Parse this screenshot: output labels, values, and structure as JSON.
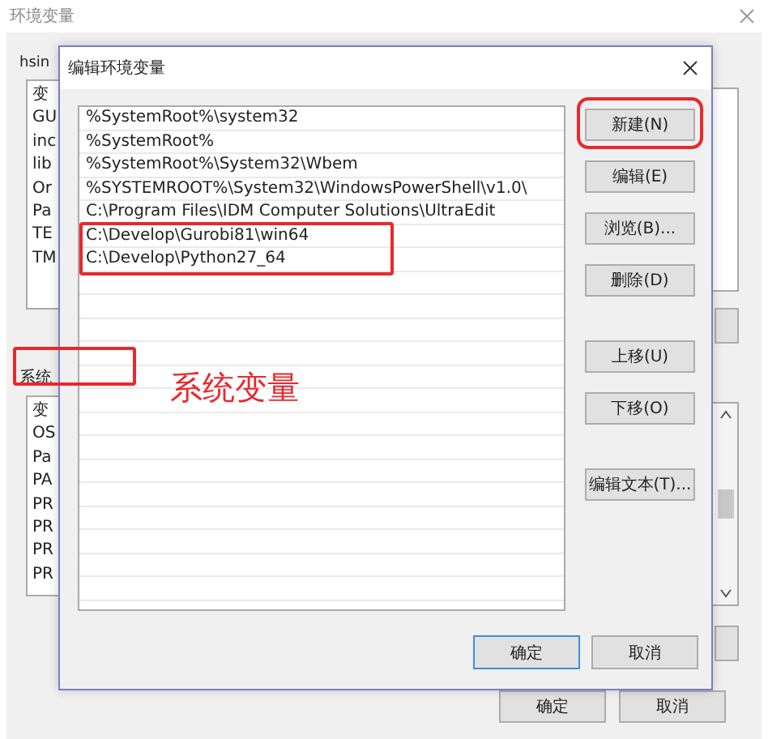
{
  "background_window": {
    "title": "环境变量",
    "user_section": {
      "label": "hsin"
    },
    "user_variables": [
      "变",
      "GU",
      "inc",
      "lib",
      "Or",
      "Pa",
      "TE",
      "TM"
    ],
    "system_section": {
      "label": "系统",
      "annotated": true
    },
    "system_variables": [
      "变",
      "OS",
      "Pa",
      "PA",
      "PR",
      "PR",
      "PR",
      "PR"
    ],
    "buttons": [
      "确定",
      "取消"
    ]
  },
  "dialog": {
    "title": "编辑环境变量",
    "entries": [
      {
        "text": "%SystemRoot%\\system32",
        "annotated": false
      },
      {
        "text": "%SystemRoot%",
        "annotated": false
      },
      {
        "text": "%SystemRoot%\\System32\\Wbem",
        "annotated": false
      },
      {
        "text": "%SYSTEMROOT%\\System32\\WindowsPowerShell\\v1.0\\",
        "annotated": false
      },
      {
        "text": "C:\\Program Files\\IDM Computer Solutions\\UltraEdit",
        "annotated": false
      },
      {
        "text": "C:\\Develop\\Gurobi81\\win64",
        "annotated": true
      },
      {
        "text": "C:\\Develop\\Python27_64",
        "annotated": true
      }
    ],
    "side_button_groups": [
      [
        {
          "label": "新建(N)",
          "annotated": true
        },
        {
          "label": "编辑(E)",
          "annotated": false
        },
        {
          "label": "浏览(B)...",
          "annotated": false
        },
        {
          "label": "删除(D)",
          "annotated": false
        }
      ],
      [
        {
          "label": "上移(U)",
          "annotated": false
        },
        {
          "label": "下移(O)",
          "annotated": false
        }
      ],
      [
        {
          "label": "编辑文本(T)...",
          "annotated": false
        }
      ]
    ],
    "buttons": [
      {
        "label": "确定",
        "default": true
      },
      {
        "label": "取消",
        "default": false
      }
    ]
  },
  "annotation_text": "系统变量"
}
